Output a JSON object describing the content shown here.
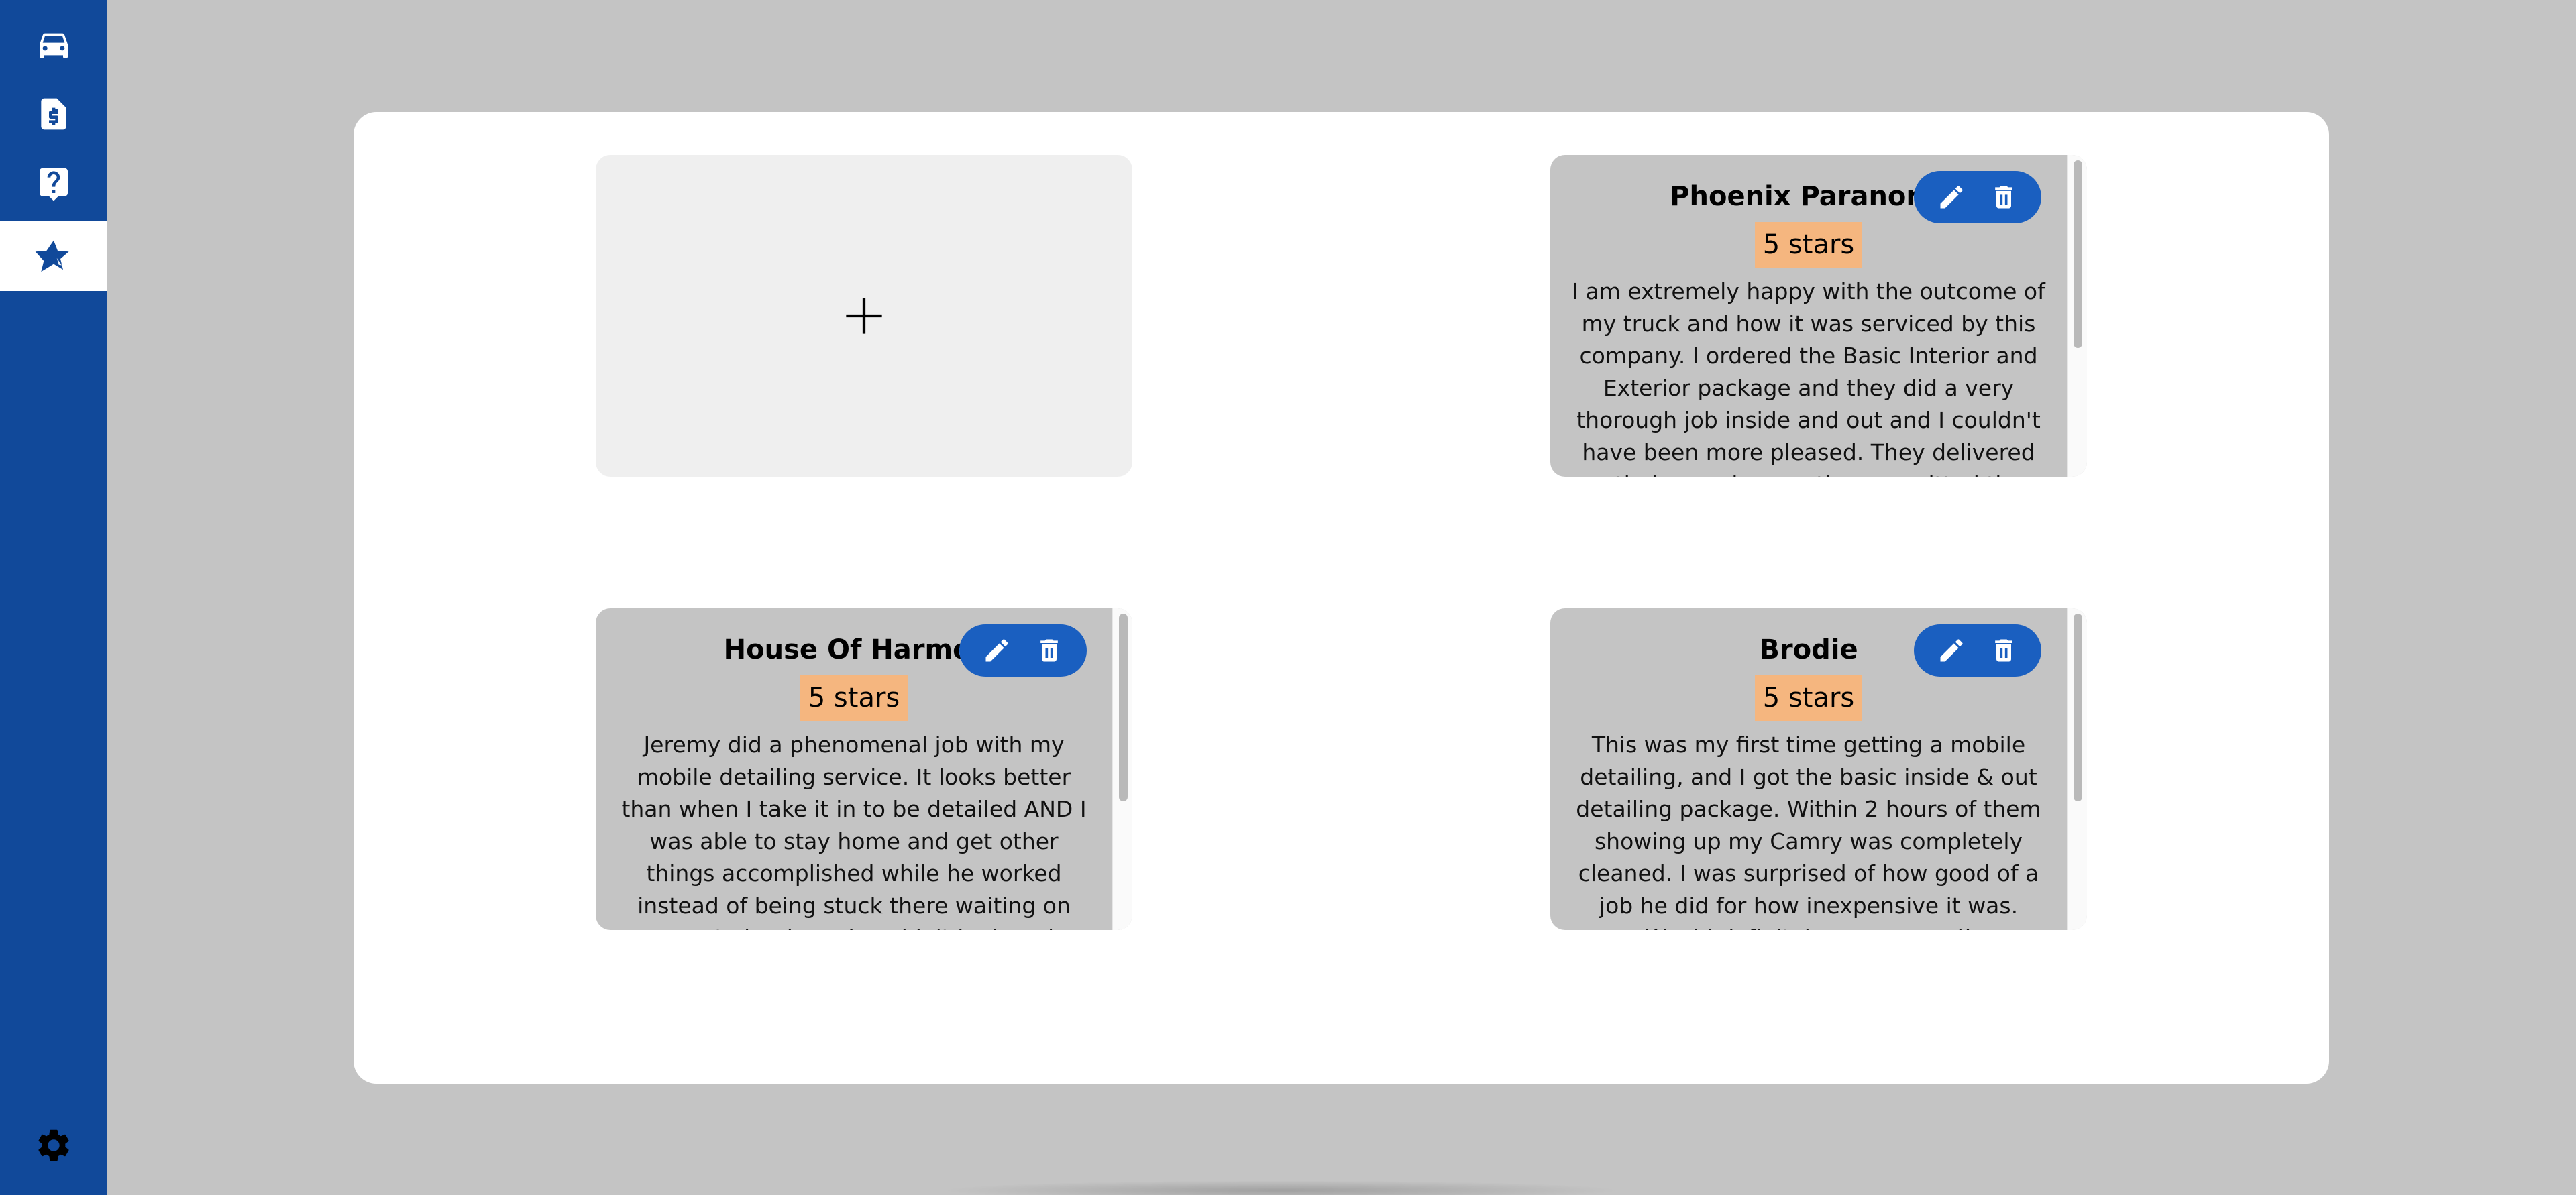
{
  "sidebar": {
    "items": [
      {
        "icon": "car-icon",
        "active": false
      },
      {
        "icon": "invoice-icon",
        "active": false
      },
      {
        "icon": "help-icon",
        "active": false
      },
      {
        "icon": "reviews-star-icon",
        "active": true
      }
    ],
    "settings_icon": "gear-icon"
  },
  "add_card": {
    "icon": "plus-icon"
  },
  "reviews": [
    {
      "name": "Phoenix Paranorm",
      "rating": "5 stars",
      "text": "I am extremely happy with the outcome of my truck and how it was serviced by this company. I ordered the Basic Interior and Exterior package and they did a very thorough job inside and out and I couldn't have been more pleased. They delivered on their promises on the committed time slot"
    },
    {
      "name": "House Of Harmor",
      "rating": "5 stars",
      "text": "Jeremy did a phenomenal job with my mobile detailing service. It looks better than when I take it in to be detailed AND I was able to stay home and get other things accomplished while he worked instead of being stuck there waiting on my car to be done. I couldn't be happier with the service"
    },
    {
      "name": "Brodie",
      "rating": "5 stars",
      "text": "This was my first time getting a mobile detailing, and I got the basic inside & out detailing package. Within 2 hours of them showing up my Camry was completely cleaned. I was surprised of how good of a job he did for how inexpensive it was. Would definitely recommend!"
    }
  ],
  "colors": {
    "sidebar": "#11499a",
    "accent_button": "#1a5fc0",
    "rating_badge": "#f5b67f",
    "page_background": "#c4c4c4"
  }
}
